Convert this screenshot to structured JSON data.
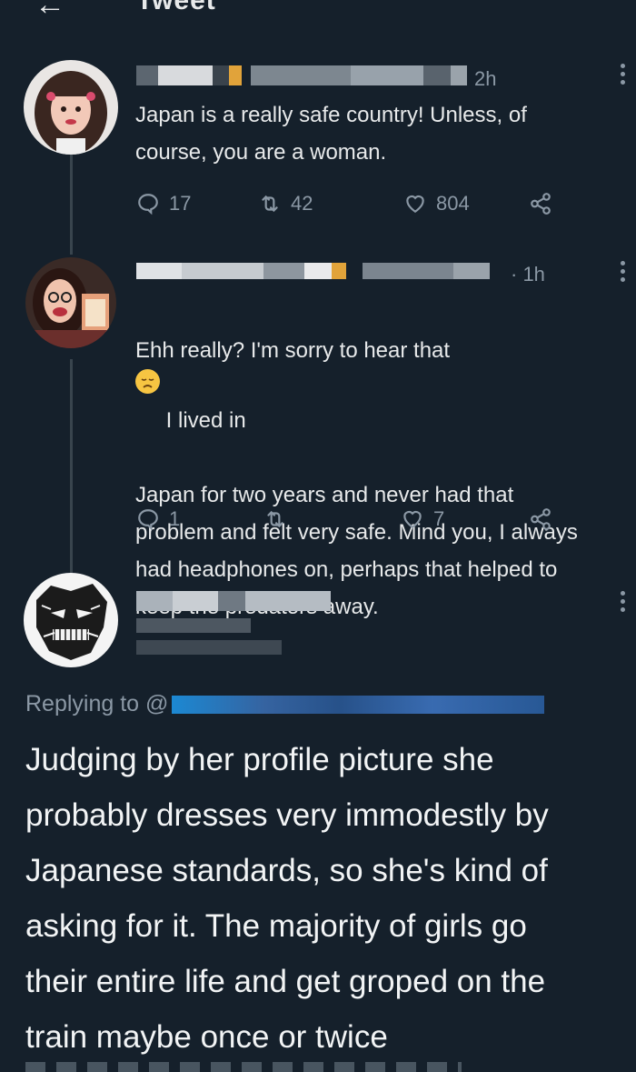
{
  "header": {
    "back_icon": "arrow-left-icon",
    "title": "Tweet"
  },
  "tweets": [
    {
      "time": "2h",
      "text": "Japan is a really safe country! Unless, of\ncourse, you are a woman.",
      "replies": "17",
      "retweets": "42",
      "likes": "804"
    },
    {
      "time": "· 1h",
      "text_before_emoji": "Ehh really? I'm sorry to hear that",
      "emoji": "disappointed-face-emoji",
      "text_after_emoji": " I lived in",
      "text_rest": "Japan for two years and never had that\nproblem and felt very safe. Mind you, I always\nhad headphones on, perhaps that helped to\nkeep the predators away.",
      "replies": "1",
      "retweets": "",
      "likes": "7"
    }
  ],
  "main_tweet": {
    "replying_to_label": "Replying to @",
    "text": "Judging by her profile picture she\nprobably dresses very immodestly by\nJapanese standards, so she's kind of\nasking for it. The majority of girls go\ntheir entire life and get groped on the\ntrain maybe once or twice"
  },
  "colors": {
    "background": "#15202b",
    "text": "#e7e9ea",
    "muted": "#8b98a5",
    "accent": "#1d9bf0"
  }
}
